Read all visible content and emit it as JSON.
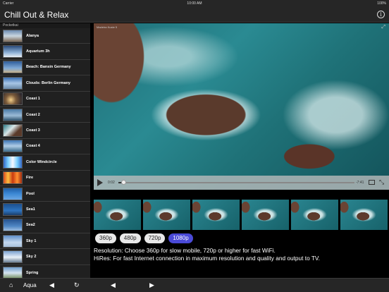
{
  "status": {
    "carrier": "Carrier",
    "time": "10:00 AM",
    "battery": "100%"
  },
  "nav": {
    "title": "Chill Out & Relax",
    "info_icon": "i"
  },
  "sidebar": {
    "header": "Pocketkai",
    "items": [
      {
        "label": "Alanya"
      },
      {
        "label": "Aquarium 3h"
      },
      {
        "label": "Beach: Bansin Germany"
      },
      {
        "label": "Clouds: Berlin Germany"
      },
      {
        "label": "Coast 1"
      },
      {
        "label": "Coast 2"
      },
      {
        "label": "Coast 3"
      },
      {
        "label": "Coast 4"
      },
      {
        "label": "Color Windcircle"
      },
      {
        "label": "Fire"
      },
      {
        "label": "Pool"
      },
      {
        "label": "Sea1"
      },
      {
        "label": "Sea2"
      },
      {
        "label": "Sky 1"
      },
      {
        "label": "Sky 2"
      },
      {
        "label": "Spring"
      }
    ]
  },
  "video": {
    "title": "Madeira Kuste 5",
    "expand_icon": "⤢",
    "current_time": "0:02",
    "remaining_time": "-7:41",
    "progress": 0.02,
    "fullscreen_icon": "⤡"
  },
  "resolutions": {
    "r360": "360p",
    "r480": "480p",
    "r720": "720p",
    "r1080": "1080p",
    "selected": "1080p"
  },
  "info": {
    "line1": "Resolution: Choose 360p for slow mobile, 720p or higher for fast WiFi.",
    "line2": "HiRes: For fast Internet connection in maximum resolution and quality and output to TV."
  },
  "toolbar": {
    "home_icon": "⌂",
    "aqua_label": "Aqua",
    "back_icon": "◀",
    "refresh_icon": "↻",
    "back2_icon": "◀",
    "forward_icon": "▶"
  }
}
